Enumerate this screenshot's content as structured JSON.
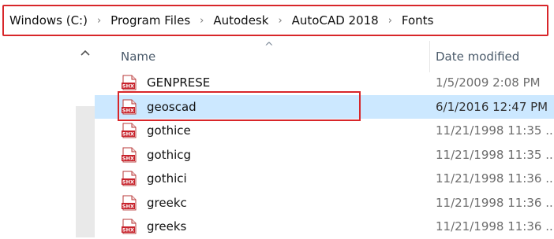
{
  "breadcrumb": {
    "items": [
      "Windows (C:)",
      "Program Files",
      "Autodesk",
      "AutoCAD 2018",
      "Fonts"
    ],
    "separator": "›"
  },
  "columns": {
    "name": "Name",
    "date_modified": "Date modified",
    "sort_indicator": "^"
  },
  "files": [
    {
      "name": "GENPRESE",
      "date": "1/5/2009 2:08 PM",
      "icon": "shx-file-icon",
      "selected": false
    },
    {
      "name": "geoscad",
      "date": "6/1/2016 12:47 PM",
      "icon": "shx-file-icon",
      "selected": true
    },
    {
      "name": "gothice",
      "date": "11/21/1998 11:35 ...",
      "icon": "shx-file-icon",
      "selected": false
    },
    {
      "name": "gothicg",
      "date": "11/21/1998 11:35 ...",
      "icon": "shx-file-icon",
      "selected": false
    },
    {
      "name": "gothici",
      "date": "11/21/1998 11:36 ...",
      "icon": "shx-file-icon",
      "selected": false
    },
    {
      "name": "greekc",
      "date": "11/21/1998 11:36 ...",
      "icon": "shx-file-icon",
      "selected": false
    },
    {
      "name": "greeks",
      "date": "11/21/1998 11:36 ...",
      "icon": "shx-file-icon",
      "selected": false
    }
  ],
  "icon_label": "SHX",
  "colors": {
    "selection": "#cce8ff",
    "annotation": "#d8262a",
    "icon_red": "#c8232c"
  }
}
